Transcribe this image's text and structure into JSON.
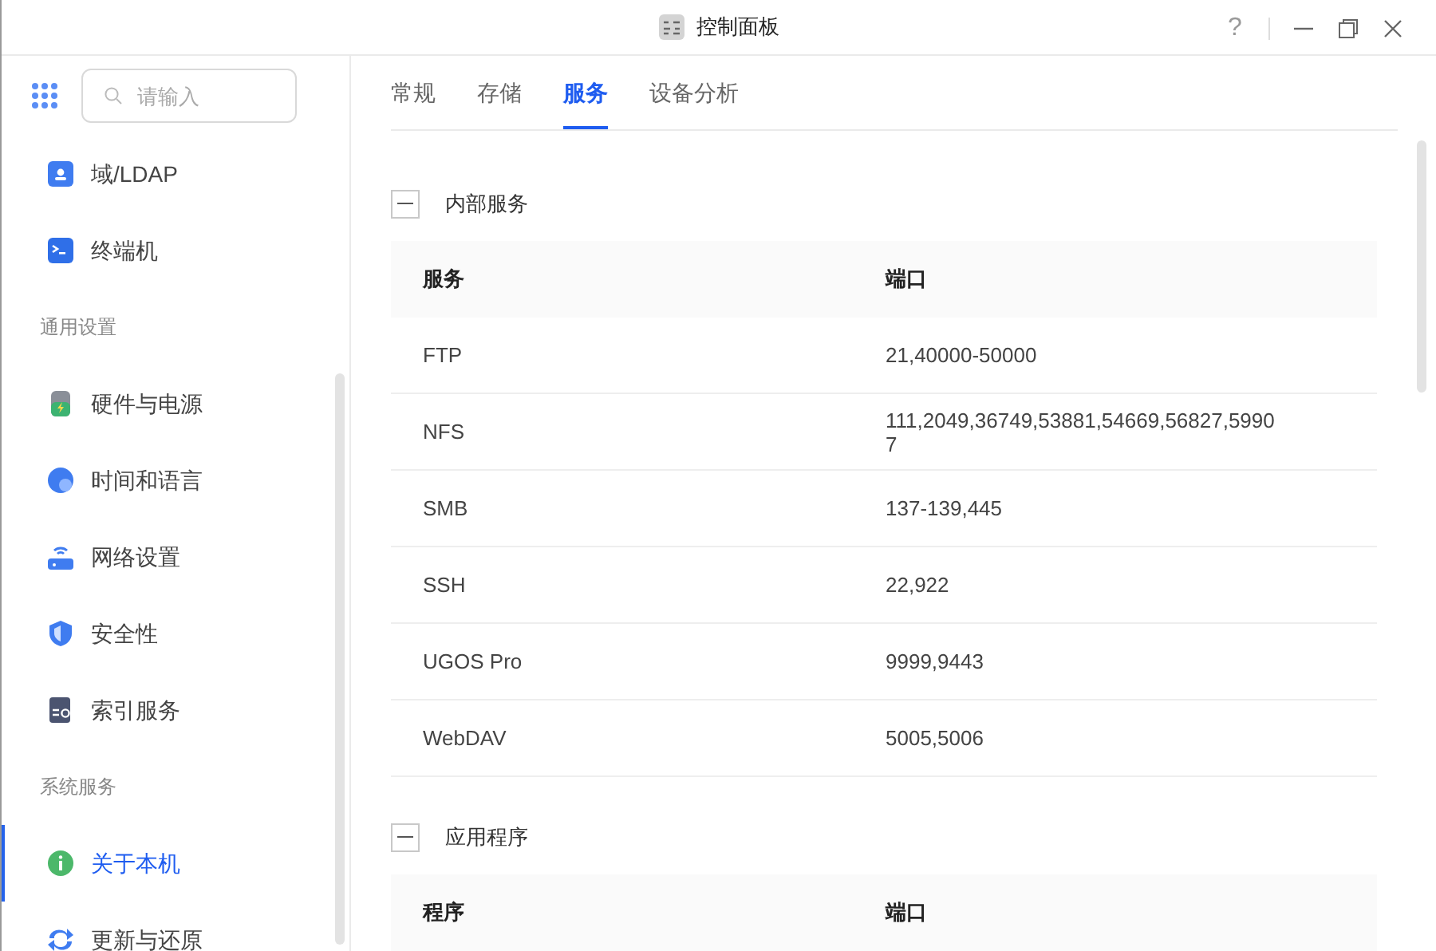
{
  "window": {
    "title": "控制面板",
    "controls": [
      "?"
    ]
  },
  "search": {
    "placeholder": "请输入"
  },
  "sidebar": {
    "items": [
      {
        "kind": "item",
        "label": "域/LDAP",
        "selected": false
      },
      {
        "kind": "item",
        "label": "终端机",
        "selected": false
      },
      {
        "kind": "header",
        "label": "通用设置"
      },
      {
        "kind": "item",
        "label": "硬件与电源",
        "selected": false
      },
      {
        "kind": "item",
        "label": "时间和语言",
        "selected": false
      },
      {
        "kind": "item",
        "label": "网络设置",
        "selected": false
      },
      {
        "kind": "item",
        "label": "安全性",
        "selected": false
      },
      {
        "kind": "item",
        "label": "索引服务",
        "selected": false
      },
      {
        "kind": "header",
        "label": "系统服务"
      },
      {
        "kind": "item",
        "label": "关于本机",
        "selected": true
      },
      {
        "kind": "item",
        "label": "更新与还原",
        "selected": false
      }
    ]
  },
  "tabs": [
    {
      "label": "常规",
      "selected": false
    },
    {
      "label": "存储",
      "selected": false
    },
    {
      "label": "服务",
      "selected": true
    },
    {
      "label": "设备分析",
      "selected": false
    }
  ],
  "sections": [
    {
      "title": "内部服务",
      "expanded": true,
      "columns": [
        "服务",
        "端口"
      ],
      "rows": [
        [
          "FTP",
          "21,40000-50000"
        ],
        [
          "NFS",
          "111,2049,36749,53881,54669,56827,59907"
        ],
        [
          "SMB",
          "137-139,445"
        ],
        [
          "SSH",
          "22,922"
        ],
        [
          "UGOS Pro",
          "9999,9443"
        ],
        [
          "WebDAV",
          "5005,5006"
        ]
      ]
    },
    {
      "title": "应用程序",
      "expanded": true,
      "columns": [
        "程序",
        "端口"
      ]
    }
  ]
}
